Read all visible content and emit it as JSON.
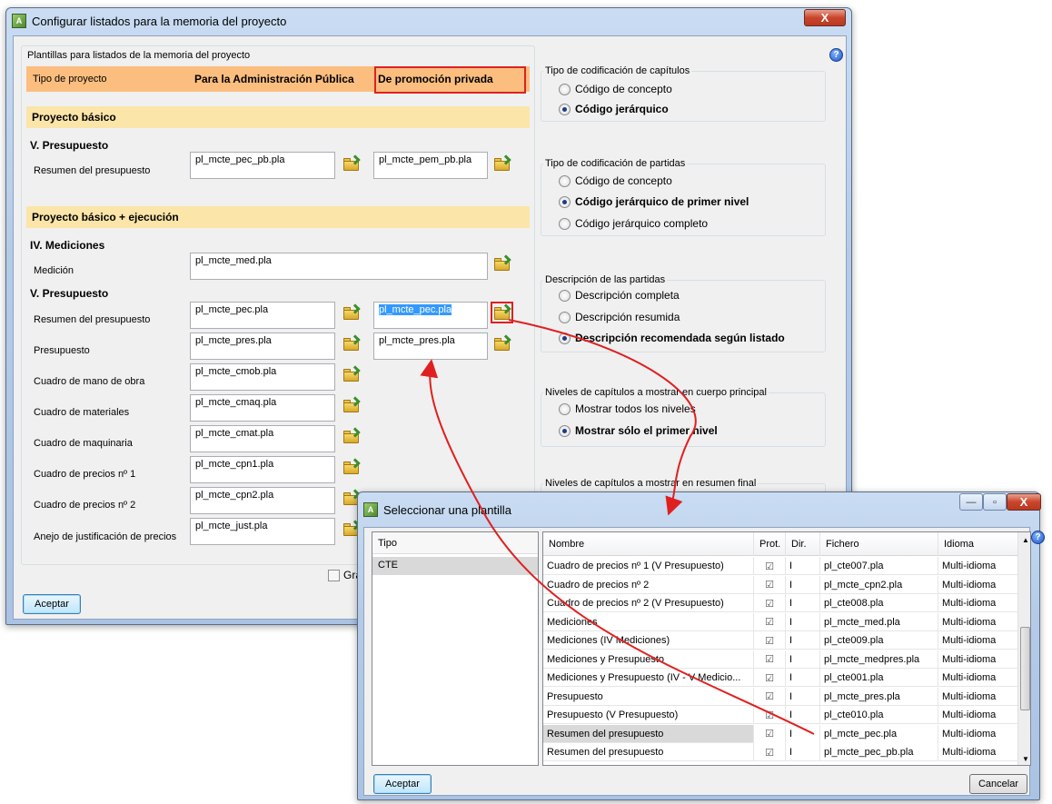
{
  "main_window": {
    "title": "Configurar listados para la memoria del proyecto",
    "close_glyph": "X",
    "help_glyph": "?",
    "group_title": "Plantillas para listados de la memoria del proyecto",
    "header": {
      "tipo_label": "Tipo de proyecto",
      "col1": "Para la Administración Pública",
      "col2": "De promoción privada"
    },
    "section_basico": "Proyecto básico",
    "sub_v_presupuesto_1": "V. Presupuesto",
    "row_resumen_1": {
      "label": "Resumen del presupuesto",
      "value1": "pl_mcte_pec_pb.pla",
      "value2": "pl_mcte_pem_pb.pla"
    },
    "section_ejecucion": "Proyecto básico + ejecución",
    "sub_iv_mediciones": "IV. Mediciones",
    "row_medicion": {
      "label": "Medición",
      "value1": "pl_mcte_med.pla"
    },
    "sub_v_presupuesto_2": "V. Presupuesto",
    "row_resumen_2": {
      "label": "Resumen del presupuesto",
      "value1": "pl_mcte_pec.pla",
      "value2": "pl_mcte_pec.pla"
    },
    "row_presupuesto": {
      "label": "Presupuesto",
      "value1": "pl_mcte_pres.pla",
      "value2": "pl_mcte_pres.pla"
    },
    "row_mano_obra": {
      "label": "Cuadro de mano de obra",
      "value1": "pl_mcte_cmob.pla"
    },
    "row_materiales": {
      "label": "Cuadro de materiales",
      "value1": "pl_mcte_cmaq.pla"
    },
    "row_maquinaria": {
      "label": "Cuadro de maquinaria",
      "value1": "pl_mcte_cmat.pla"
    },
    "row_precios1": {
      "label": "Cuadro de precios nº 1",
      "value1": "pl_mcte_cpn1.pla"
    },
    "row_precios2": {
      "label": "Cuadro de precios nº 2",
      "value1": "pl_mcte_cpn2.pla"
    },
    "row_anejo": {
      "label": "Anejo de justificación de precios",
      "value1": "pl_mcte_just.pla"
    },
    "grabar_checkbox_label": "Gra",
    "accept_button": "Aceptar",
    "right_groups": {
      "codif_capitulos": {
        "title": "Tipo de codificación de capítulos",
        "options": [
          "Código de concepto",
          "Código jerárquico"
        ],
        "selected": 1
      },
      "codif_partidas": {
        "title": "Tipo de codificación de partidas",
        "options": [
          "Código de concepto",
          "Código jerárquico de primer nivel",
          "Código jerárquico completo"
        ],
        "selected": 1
      },
      "descripcion": {
        "title": "Descripción de las partidas",
        "options": [
          "Descripción completa",
          "Descripción resumida",
          "Descripción recomendada según listado"
        ],
        "selected": 2
      },
      "niveles_cuerpo": {
        "title": "Niveles de capítulos a mostrar en cuerpo principal",
        "options": [
          "Mostrar todos los niveles",
          "Mostrar sólo el primer nivel"
        ],
        "selected": 1
      },
      "niveles_resumen": {
        "title": "Niveles de capítulos a mostrar en resumen final"
      }
    }
  },
  "template_dialog": {
    "title": "Seleccionar una plantilla",
    "minimize_glyph": "—",
    "maximize_glyph": "▫",
    "close_glyph": "X",
    "help_glyph": "?",
    "tipo_header": "Tipo",
    "tipo_items": [
      "CTE"
    ],
    "columns": [
      "Nombre",
      "Prot.",
      "Dir.",
      "Fichero",
      "Idioma"
    ],
    "rows": [
      {
        "nombre": "Cuadro de precios nº 1 (V  Presupuesto)",
        "prot": "☑",
        "dir": "I",
        "fichero": "pl_cte007.pla",
        "idioma": "Multi-idioma"
      },
      {
        "nombre": "Cuadro de precios nº 2",
        "prot": "☑",
        "dir": "I",
        "fichero": "pl_mcte_cpn2.pla",
        "idioma": "Multi-idioma"
      },
      {
        "nombre": "Cuadro de precios nº 2 (V Presupuesto)",
        "prot": "☑",
        "dir": "I",
        "fichero": "pl_cte008.pla",
        "idioma": "Multi-idioma"
      },
      {
        "nombre": "Mediciones",
        "prot": "☑",
        "dir": "I",
        "fichero": "pl_mcte_med.pla",
        "idioma": "Multi-idioma"
      },
      {
        "nombre": "Mediciones (IV Mediciones)",
        "prot": "☑",
        "dir": "I",
        "fichero": "pl_cte009.pla",
        "idioma": "Multi-idioma"
      },
      {
        "nombre": "Mediciones y Presupuesto",
        "prot": "☑",
        "dir": "I",
        "fichero": "pl_mcte_medpres.pla",
        "idioma": "Multi-idioma"
      },
      {
        "nombre": "Mediciones y Presupuesto (IV - V Medicio...",
        "prot": "☑",
        "dir": "I",
        "fichero": "pl_cte001.pla",
        "idioma": "Multi-idioma"
      },
      {
        "nombre": "Presupuesto",
        "prot": "☑",
        "dir": "I",
        "fichero": "pl_mcte_pres.pla",
        "idioma": "Multi-idioma"
      },
      {
        "nombre": "Presupuesto (V Presupuesto)",
        "prot": "☑",
        "dir": "I",
        "fichero": "pl_cte010.pla",
        "idioma": "Multi-idioma"
      },
      {
        "nombre": "Resumen del presupuesto",
        "prot": "☑",
        "dir": "I",
        "fichero": "pl_mcte_pec.pla",
        "idioma": "Multi-idioma"
      },
      {
        "nombre": "Resumen del presupuesto",
        "prot": "☑",
        "dir": "I",
        "fichero": "pl_mcte_pec_pb.pla",
        "idioma": "Multi-idioma"
      }
    ],
    "selected_row": 9,
    "accept_button": "Aceptar",
    "cancel_button": "Cancelar"
  },
  "colors": {
    "header_orange": "#fbbe7e",
    "section_yellow": "#fbe5a8",
    "highlight_red": "#e02020",
    "selection_blue": "#3399ff"
  }
}
